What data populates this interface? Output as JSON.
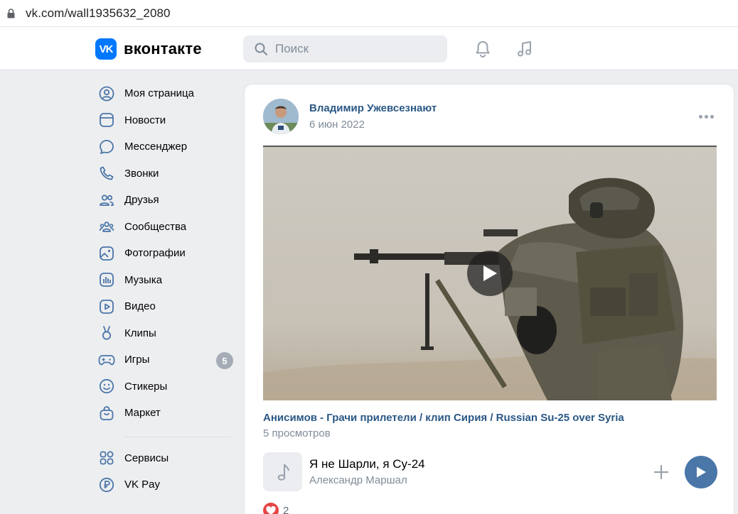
{
  "browser": {
    "url": "vk.com/wall1935632_2080",
    "lock_icon": "lock-icon"
  },
  "header": {
    "logo_mark": "VK",
    "logo_text": "вконтакте",
    "search_placeholder": "Поиск",
    "icons": [
      "bell-icon",
      "music-note-icon"
    ],
    "accent": "#0077ff"
  },
  "sidebar": {
    "items": [
      {
        "label": "Моя страница",
        "icon": "user-circle-icon"
      },
      {
        "label": "Новости",
        "icon": "news-icon"
      },
      {
        "label": "Мессенджер",
        "icon": "message-bubble-icon"
      },
      {
        "label": "Звонки",
        "icon": "phone-icon"
      },
      {
        "label": "Друзья",
        "icon": "friends-icon"
      },
      {
        "label": "Сообщества",
        "icon": "communities-icon"
      },
      {
        "label": "Фотографии",
        "icon": "photo-icon"
      },
      {
        "label": "Музыка",
        "icon": "music-icon"
      },
      {
        "label": "Видео",
        "icon": "video-icon"
      },
      {
        "label": "Клипы",
        "icon": "clips-icon"
      },
      {
        "label": "Игры",
        "icon": "gamepad-icon",
        "badge": "5"
      },
      {
        "label": "Стикеры",
        "icon": "smile-icon"
      },
      {
        "label": "Маркет",
        "icon": "bag-icon"
      }
    ],
    "extra_items": [
      {
        "label": "Сервисы",
        "icon": "grid-icon"
      },
      {
        "label": "VK Pay",
        "icon": "ruble-icon"
      }
    ]
  },
  "post": {
    "author": "Владимир Ужевсезнают",
    "date": "6 июн 2022",
    "video": {
      "title": "Анисимов - Грачи прилетели / клип Сирия / Russian Su-25 over Syria",
      "views": "5 просмотров"
    },
    "audio": {
      "title": "Я не Шарли, я Су-24",
      "artist": "Александр Маршал"
    },
    "likes": "2",
    "link_color": "#2a5885",
    "play_color": "#4a76a8"
  }
}
